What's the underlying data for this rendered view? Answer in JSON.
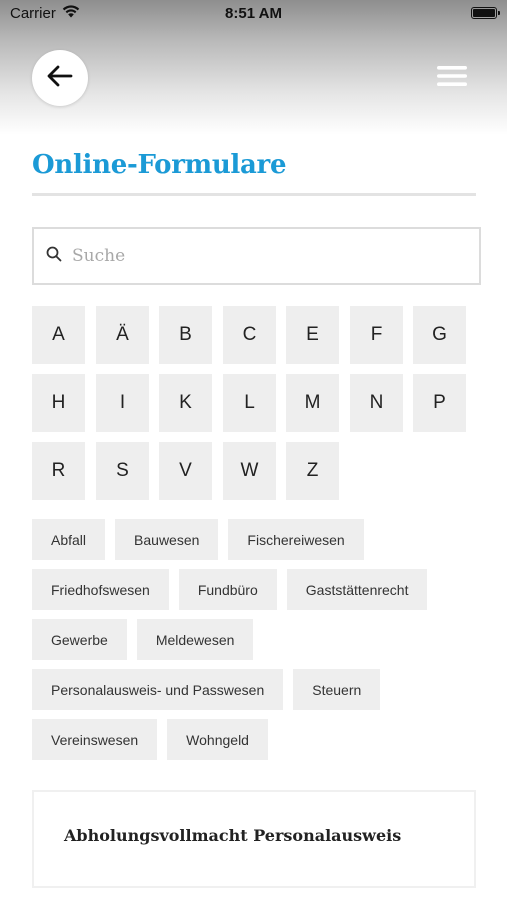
{
  "status_bar": {
    "carrier": "Carrier",
    "time": "8:51 AM",
    "icons": [
      "wifi-icon",
      "battery-icon"
    ]
  },
  "header": {
    "back_icon": "arrow-left-icon",
    "menu_icon": "hamburger-menu-icon"
  },
  "page": {
    "title": "Online-Formulare",
    "accent_color": "#1b9ad6"
  },
  "search": {
    "placeholder": "Suche",
    "value": "",
    "icon": "search-icon"
  },
  "letters": [
    "A",
    "Ä",
    "B",
    "C",
    "E",
    "F",
    "G",
    "H",
    "I",
    "K",
    "L",
    "M",
    "N",
    "P",
    "R",
    "S",
    "V",
    "W",
    "Z"
  ],
  "categories": [
    [
      "Abfall",
      "Bauwesen",
      "Fischereiwesen"
    ],
    [
      "Friedhofswesen",
      "Fundbüro",
      "Gaststättenrecht"
    ],
    [
      "Gewerbe",
      "Meldewesen"
    ],
    [
      "Personalausweis- und Passwesen",
      "Steuern"
    ],
    [
      "Vereinswesen",
      "Wohngeld"
    ]
  ],
  "results": [
    {
      "title": "Abholungsvollmacht Personalausweis"
    }
  ]
}
